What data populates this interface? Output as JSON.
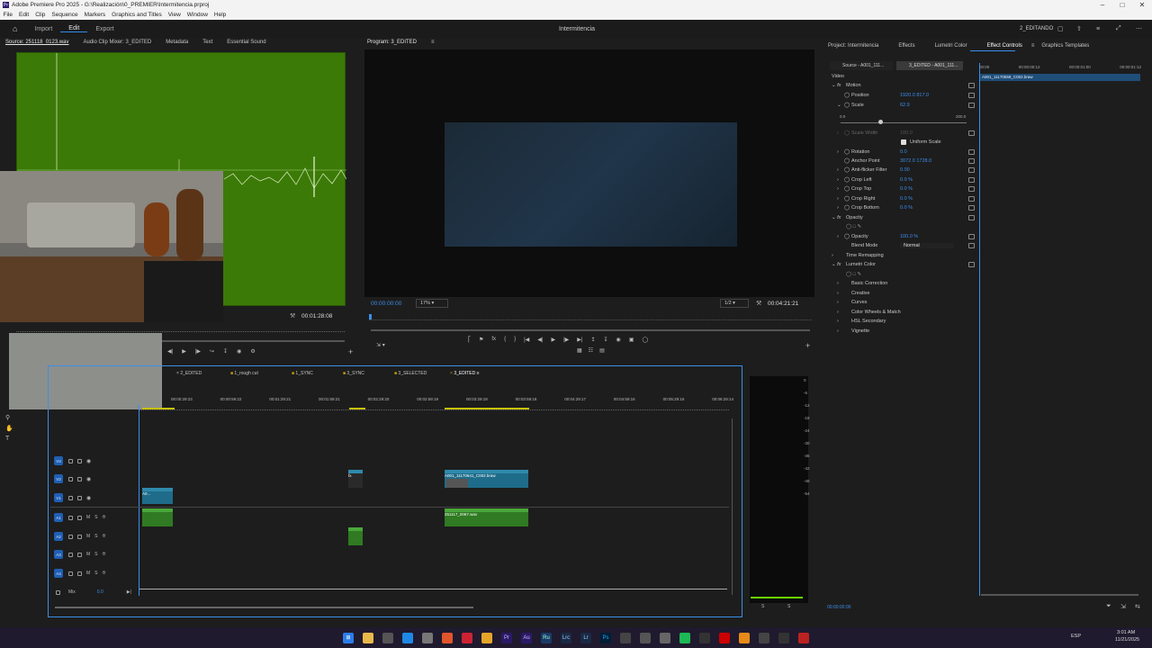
{
  "window": {
    "title": "Adobe Premiere Pro 2025 - G:\\Realización\\0_PREMIER\\Intermitencia.prproj"
  },
  "menu": [
    "File",
    "Edit",
    "Clip",
    "Sequence",
    "Markers",
    "Graphics and Titles",
    "View",
    "Window",
    "Help"
  ],
  "header": {
    "tabs": [
      "Import",
      "Edit",
      "Export"
    ],
    "active_tab": "Edit",
    "project_title": "Intermitencia",
    "workspace": "2_EDITANDO"
  },
  "source_panel": {
    "tabs": [
      "Source: 251118_0123.wav",
      "Audio Clip Mixer: 3_EDITED",
      "Metadata",
      "Text",
      "Essential Sound"
    ],
    "timecode": "00:01:28:08"
  },
  "program_panel": {
    "title": "Program: 3_EDITED",
    "current_tc": "00:00:00:00",
    "zoom": "17%",
    "quality": "1/2",
    "duration_tc": "00:04:21:21"
  },
  "right_panel": {
    "tabs": [
      "Project: Intermitencia",
      "Effects",
      "Lumetri Color",
      "Effect Controls",
      "Graphics Templates"
    ],
    "active_tab": "Effect Controls",
    "source_label": "Source - A001_111...",
    "sequence_label": "3_EDITED - A001_111...",
    "ruler": [
      "00:00",
      "00:00:00:12",
      "00:00:01:00",
      "00:00:01:12"
    ],
    "clip_name": "A001_11170559_C002.braw",
    "section_video": "Video",
    "rows": [
      {
        "name": "Motion",
        "value": "",
        "indent": 0
      },
      {
        "name": "Position",
        "value": "1920.0    817.0",
        "indent": 2
      },
      {
        "name": "Scale",
        "value": "62.9",
        "indent": 2
      },
      {
        "name": "Scale Width",
        "value": "100.0",
        "indent": 2
      },
      {
        "name": "Rotation",
        "value": "0.0",
        "indent": 2
      },
      {
        "name": "Anchor Point",
        "value": "3072.0    1728.0",
        "indent": 2
      },
      {
        "name": "Anti-flicker Filter",
        "value": "0.00",
        "indent": 2
      },
      {
        "name": "Crop Left",
        "value": "0.0 %",
        "indent": 2
      },
      {
        "name": "Crop Top",
        "value": "0.0 %",
        "indent": 2
      },
      {
        "name": "Crop Right",
        "value": "0.0 %",
        "indent": 2
      },
      {
        "name": "Crop Bottom",
        "value": "0.0 %",
        "indent": 2
      },
      {
        "name": "Opacity",
        "value": "",
        "indent": 0
      },
      {
        "name": "Opacity",
        "value": "100.0 %",
        "indent": 2
      },
      {
        "name": "Blend Mode",
        "value": "Normal",
        "indent": 2
      },
      {
        "name": "Time Remapping",
        "value": "",
        "indent": 0
      },
      {
        "name": "Lumetri Color",
        "value": "",
        "indent": 0
      },
      {
        "name": "Basic Correction",
        "value": "",
        "indent": 2
      },
      {
        "name": "Creative",
        "value": "",
        "indent": 2
      },
      {
        "name": "Curves",
        "value": "",
        "indent": 2
      },
      {
        "name": "Color Wheels & Match",
        "value": "",
        "indent": 2
      },
      {
        "name": "HSL Secondary",
        "value": "",
        "indent": 2
      },
      {
        "name": "Vignette",
        "value": "",
        "indent": 2
      }
    ],
    "scale_min": "0.0",
    "scale_max": "200.0",
    "uniform_scale": "Uniform Scale",
    "bottom_tc": "00:00:00:00"
  },
  "timeline": {
    "sequence_tabs": [
      "2_EDITED",
      "1_rough cut",
      "1_SYNC",
      "3_SYNC",
      "3_SELECTED",
      "3_EDITED"
    ],
    "active_sequence": "3_EDITED",
    "ruler": [
      "00:00:29:23",
      "00:00:59:22",
      "00:01:29:21",
      "00:01:59:21",
      "00:02:29:20",
      "00:02:59:19",
      "00:03:29:18",
      "00:03:59:18",
      "00:04:29:17",
      "00:04:59:16",
      "00:05:29:16",
      "00:06:29:14"
    ],
    "tracks": [
      "V3",
      "V2",
      "V1",
      "A1",
      "A2",
      "A3",
      "A4"
    ],
    "mix_label": "Mix",
    "mix_value": "0.0",
    "clips": {
      "v1_a": "A0...",
      "v2_fx": "fx",
      "v2_b": "A001_11170641_C002.braw",
      "a1_b": "251117_0067.wav"
    }
  },
  "meter_scale": [
    "0",
    "-6",
    "-12",
    "-18",
    "-24",
    "-30",
    "-36",
    "-42",
    "-48",
    "-54"
  ],
  "meter_footer": [
    "S",
    "S"
  ],
  "taskbar": {
    "lang": "ESP",
    "time": "3:01 AM",
    "date": "11/21/2025"
  }
}
